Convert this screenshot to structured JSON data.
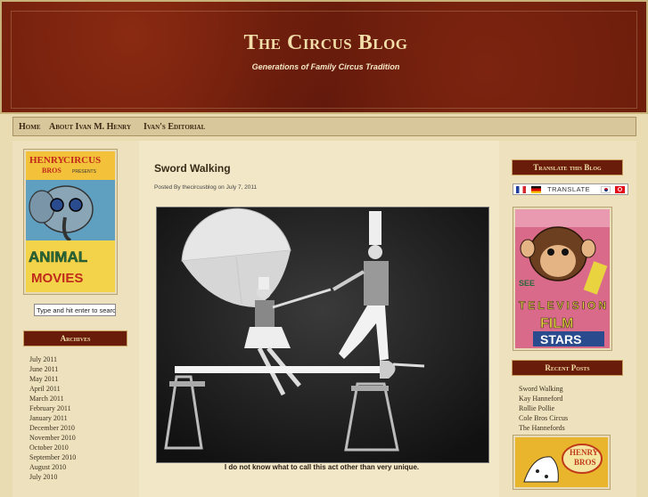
{
  "header": {
    "title": "The Circus Blog",
    "description": "Generations of Family Circus Tradition"
  },
  "nav": {
    "items": [
      "Home",
      "About Ivan M. Henry",
      "Ivan's Editorial"
    ]
  },
  "search": {
    "placeholder": "Type and hit enter to search"
  },
  "left_sidebar": {
    "poster_text": {
      "line1": "HENRY",
      "line2": "BROS",
      "line3": "CIRCUS",
      "line4": "PRESENTS",
      "line5": "ANIMAL",
      "line6": "MOVIES"
    },
    "archives_title": "Archives",
    "archives": [
      "July 2011",
      "June 2011",
      "May 2011",
      "April 2011",
      "March 2011",
      "February 2011",
      "January 2011",
      "December 2010",
      "November 2010",
      "October 2010",
      "September 2010",
      "August 2010",
      "July 2010"
    ]
  },
  "post": {
    "title": "Sword Walking",
    "meta": "Posted By thecircusblog on July 7, 2011",
    "caption": "I do not know what to call this act other than very unique."
  },
  "right_sidebar": {
    "translate_title": "Translate this Blog",
    "translate_label": "TRANSLATE",
    "poster_text": {
      "line1": "SEE",
      "line2": "TELEVISION",
      "line3": "FILM",
      "line4": "STARS"
    },
    "recent_posts_title": "Recent Posts",
    "recent_posts": [
      "Sword Walking",
      "Kay Hanneford",
      "Rollie Pollie",
      "Cole Bros Circus",
      "The Hannefords"
    ],
    "bottom_poster_text": {
      "line1": "HENRY",
      "line2": "BROS"
    }
  },
  "colors": {
    "header_bg": "#6a1c0b",
    "page_bg": "#e9dcb3",
    "title_text": "#f2dea8"
  }
}
